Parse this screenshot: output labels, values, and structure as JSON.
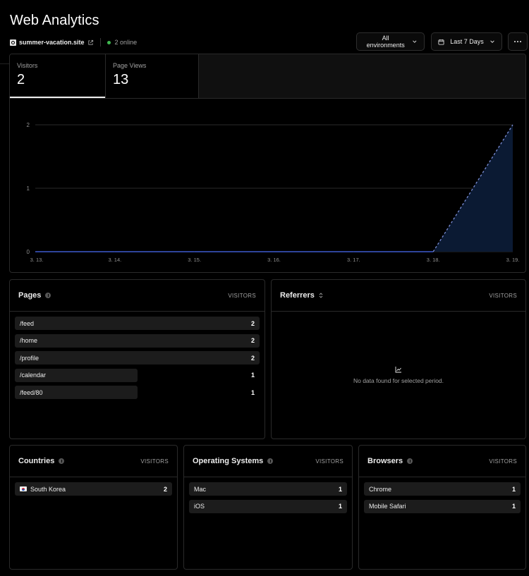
{
  "page": {
    "title": "Web Analytics"
  },
  "site": {
    "name": "summer-vacation.site",
    "online": "2 online",
    "favicon_icon": "site-favicon-icon",
    "external_icon": "external-link-icon"
  },
  "controls": {
    "environment": "All environments",
    "date_range": "Last 7 Days",
    "more_icon": "more-icon"
  },
  "tabs": [
    {
      "label": "Visitors",
      "value": "2"
    },
    {
      "label": "Page Views",
      "value": "13"
    }
  ],
  "chart_data": {
    "type": "area",
    "categories": [
      "3. 13.",
      "3. 14.",
      "3. 15.",
      "3. 16.",
      "3. 17.",
      "3. 18.",
      "3. 19."
    ],
    "series": [
      {
        "values": [
          0,
          0,
          0,
          0,
          0,
          0,
          2
        ],
        "color": "#4a6cf7",
        "fill": "#0b1a33"
      }
    ],
    "yticks": [
      "0",
      "1",
      "2"
    ],
    "ylim": [
      0,
      2
    ],
    "grid": true,
    "dashed_last_segment": true
  },
  "pages": {
    "title": "Pages",
    "column": "VISITORS",
    "rows": [
      {
        "label": "/feed",
        "value": "2",
        "fraction": 1.0
      },
      {
        "label": "/home",
        "value": "2",
        "fraction": 1.0
      },
      {
        "label": "/profile",
        "value": "2",
        "fraction": 1.0
      },
      {
        "label": "/calendar",
        "value": "1",
        "fraction": 0.5
      },
      {
        "label": "/feed/80",
        "value": "1",
        "fraction": 0.5
      }
    ]
  },
  "referrers": {
    "title": "Referrers",
    "column": "VISITORS",
    "empty": "No data found for selected period."
  },
  "countries": {
    "title": "Countries",
    "column": "VISITORS",
    "rows": [
      {
        "label": "South Korea",
        "value": "2",
        "fraction": 1.0,
        "icon": "south-korea-flag-icon"
      }
    ]
  },
  "os": {
    "title": "Operating Systems",
    "column": "VISITORS",
    "rows": [
      {
        "label": "Mac",
        "value": "1",
        "fraction": 1.0
      },
      {
        "label": "iOS",
        "value": "1",
        "fraction": 1.0
      }
    ]
  },
  "browsers": {
    "title": "Browsers",
    "column": "VISITORS",
    "rows": [
      {
        "label": "Chrome",
        "value": "1",
        "fraction": 1.0
      },
      {
        "label": "Mobile Safari",
        "value": "1",
        "fraction": 1.0
      }
    ]
  }
}
